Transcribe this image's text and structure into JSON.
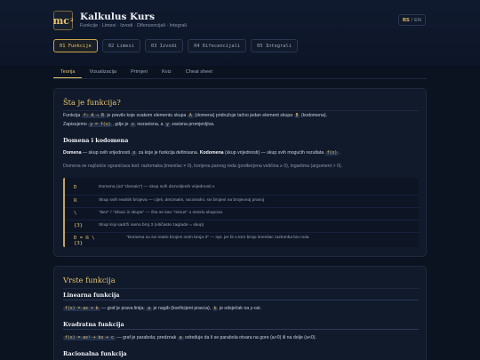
{
  "header": {
    "logo": "mc",
    "logo_sup": "2",
    "title": "Kalkulus Kurs",
    "subtitle": "Funkcije · Limesi · Izvodi · Difencencijali · Integrali",
    "lang_bs": "BS",
    "lang_sep": "/",
    "lang_en": "EN"
  },
  "chapters": [
    {
      "label": "01 Funkcije",
      "active": true
    },
    {
      "label": "02 Limesi",
      "active": false
    },
    {
      "label": "03 Izvodi",
      "active": false
    },
    {
      "label": "04 Difecencijali",
      "active": false
    },
    {
      "label": "05 Integrali",
      "active": false
    }
  ],
  "tabs": [
    {
      "label": "Teorija",
      "active": true
    },
    {
      "label": "Vizualizacija",
      "active": false
    },
    {
      "label": "Primjeri",
      "active": false
    },
    {
      "label": "Kviz",
      "active": false
    },
    {
      "label": "Cheat sheet",
      "active": false
    }
  ],
  "card1": {
    "title": "Šta je funkcija?",
    "p1_a": "Funkcija",
    "p1_code1": "f: A → B",
    "p1_b": "je pravilo koje svakom elementu skupa",
    "p1_code2": "A",
    "p1_c": "(domena) pridružuje tačno jedan element skupa",
    "p1_code3": "B",
    "p1_d": "(kodomena).",
    "p2_a": "Zapisujemo",
    "p2_code1": "y = f(x)",
    "p2_b": ", gdje je",
    "p2_code2": "x",
    "p2_c": "nezavisna, a",
    "p2_code3": "y",
    "p2_d": "zavisna promjenljiva.",
    "h_domain": "Domena i kodomena",
    "p3_b1": "Domena",
    "p3_a": "— skup svih vrijednosti",
    "p3_code1": "x",
    "p3_b": "za koje je funkcija definisana.",
    "p3_b2": "Kodomena",
    "p3_c": "(skup vrijednosti) — skup svih mogućih rezultata",
    "p3_code2": "f(x)",
    "p3_d": ".",
    "p4": "Domena se najčešće ograničava kod: razlomaka (imenilac ≠ 0), korijena parnog reda (podkorjena veličina ≥ 0), logaritma (argument > 0).",
    "symbols": [
      {
        "sym": "D",
        "desc": "Domena (od \"domain\") — skup svih dozvoljenih vrijednosti x"
      },
      {
        "sym": "ℝ",
        "desc": "Skup svih realnih brojeva — cijeli, decimalni, racionalni, svi brojevi na brojevnoj pravoj"
      },
      {
        "sym": "\\",
        "desc": "\"Bez\" / \"izbaci iz skupa\" — čita se kao \"minus\" u smislu skupova"
      },
      {
        "sym": "{3}",
        "desc": "Skup koji sadrži samo broj 3 (vitičaste zagrade = skup)"
      },
      {
        "sym": "D = ℝ \\ {3}",
        "desc": "\"Domena su svi realni brojevi osim broja 3\" — npr. jer bi u tom broju imenilac razlomka bio nula"
      }
    ]
  },
  "card2": {
    "title": "Vrste funkcija",
    "h_lin": "Linearna funkcija",
    "lin_code": "f(x) = ax + b",
    "lin_a": "— graf je prava linija;",
    "lin_code2": "a",
    "lin_b": "je nagib (koeficijent pravca),",
    "lin_code3": "b",
    "lin_c": "je odsječak na y-osi.",
    "h_quad": "Kvadratna funkcija",
    "quad_code": "f(x) = ax² + bx + c",
    "quad_a": "— graf je parabola; predznak",
    "quad_code2": "a",
    "quad_b": "određuje da li se parabola otvara na gore (a>0) ili na dolje (a<0).",
    "h_rat": "Racionalna funkcija"
  },
  "colors": {
    "accent": "#e6c36a",
    "bg": "#0b1220",
    "card": "#111a2b"
  }
}
